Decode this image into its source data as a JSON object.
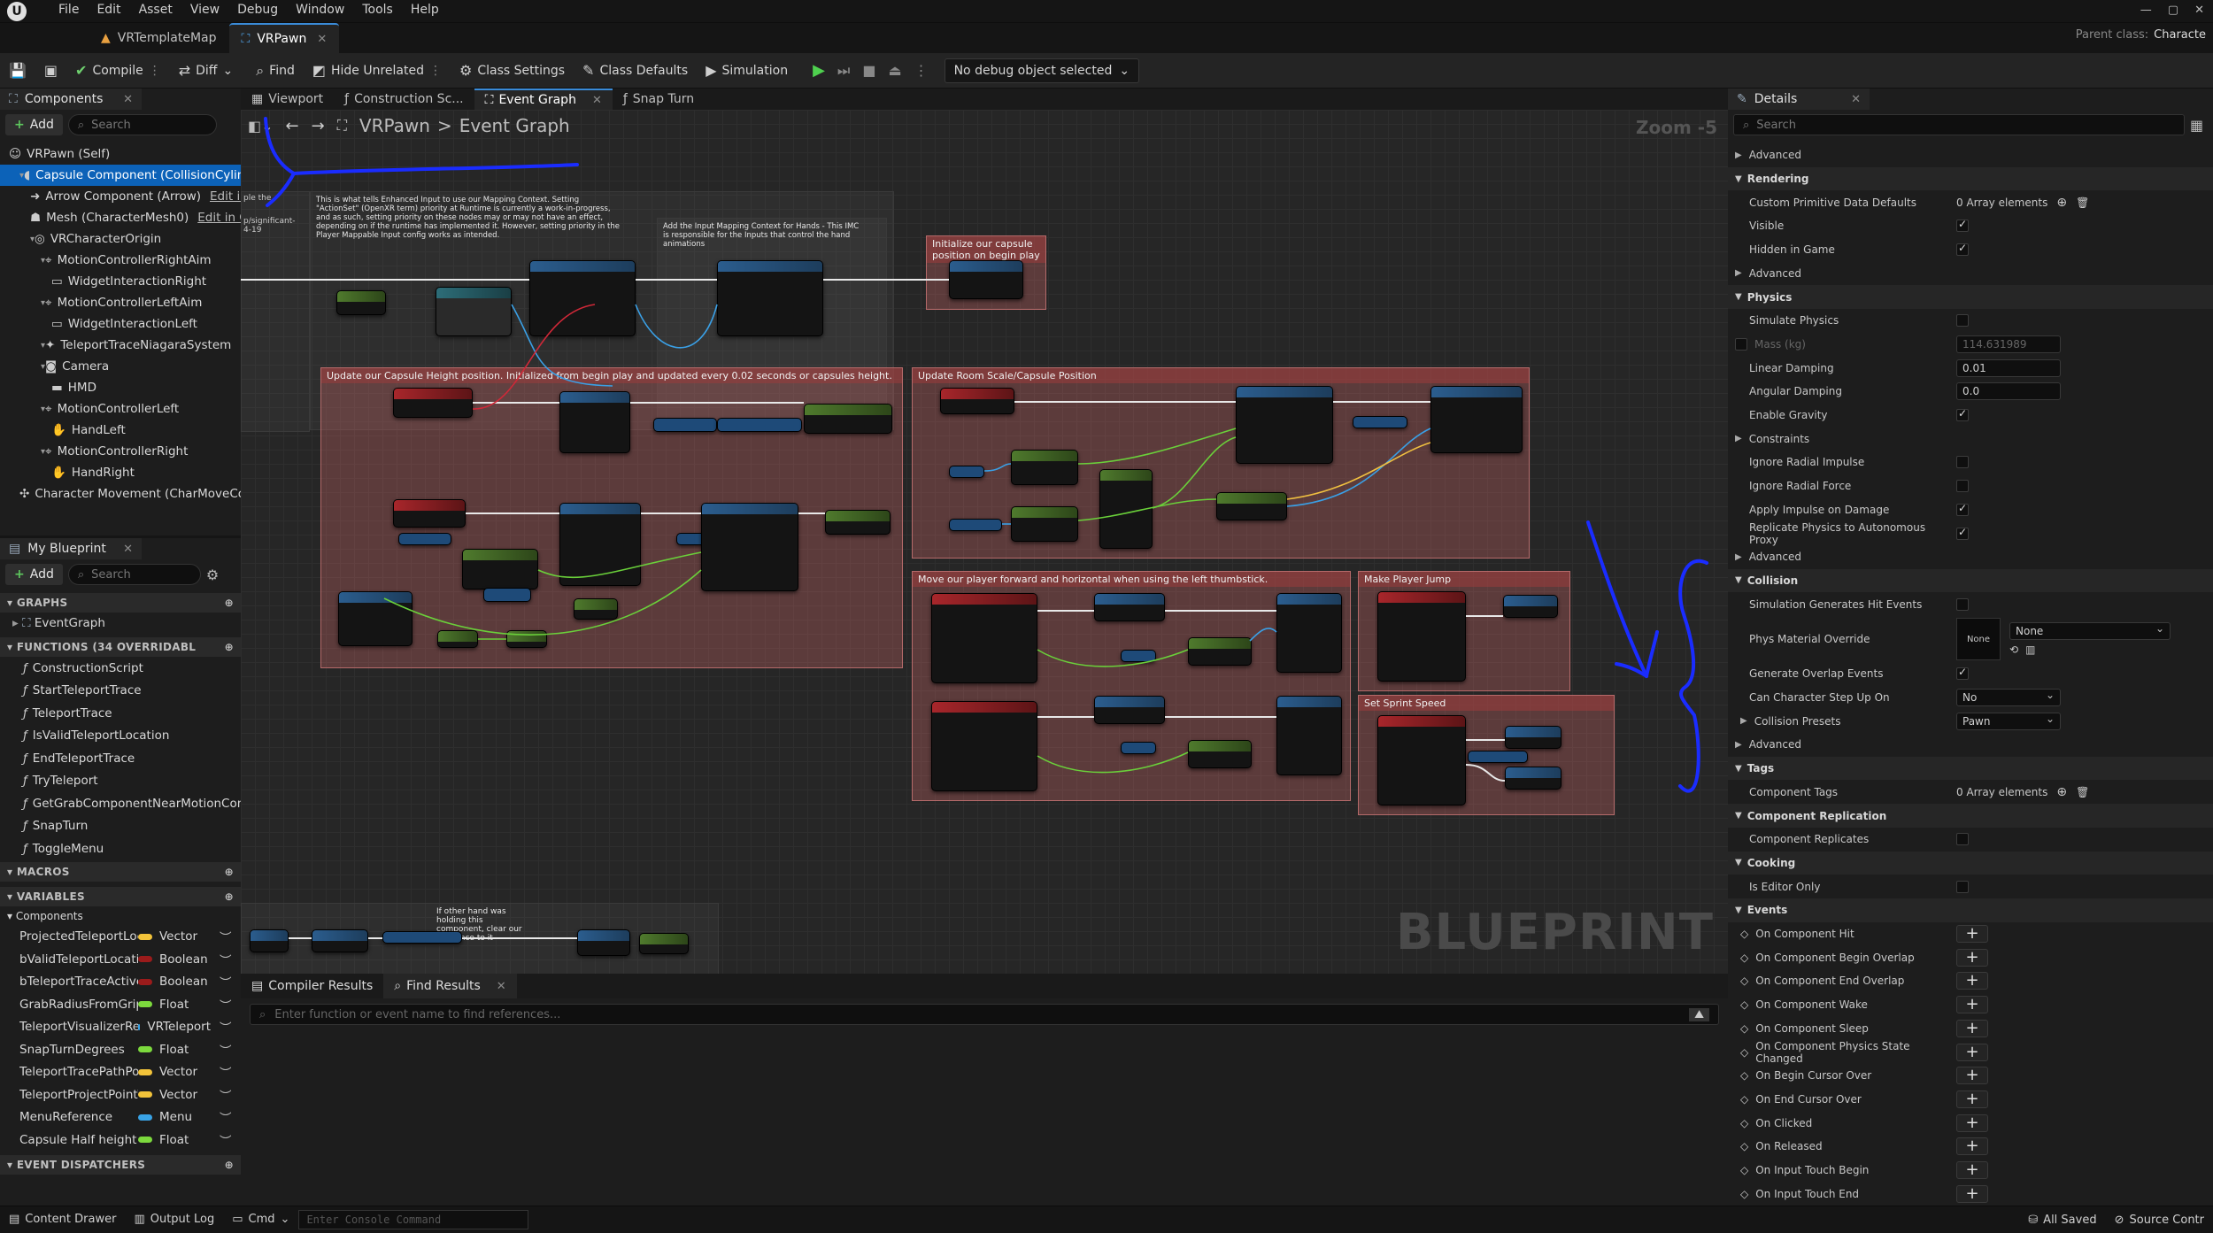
{
  "menu": [
    "File",
    "Edit",
    "Asset",
    "View",
    "Debug",
    "Window",
    "Tools",
    "Help"
  ],
  "doc_tabs": [
    {
      "label": "VRTemplateMap",
      "active": false
    },
    {
      "label": "VRPawn",
      "active": true
    }
  ],
  "parent_class": {
    "label": "Parent class:",
    "value": "Characte"
  },
  "toolbar": {
    "compile": "Compile",
    "diff": "Diff",
    "find": "Find",
    "hide_unrelated": "Hide Unrelated",
    "class_settings": "Class Settings",
    "class_defaults": "Class Defaults",
    "simulation": "Simulation",
    "debug_object": "No debug object selected"
  },
  "components": {
    "tab": "Components",
    "add": "Add",
    "search_placeholder": "Search",
    "items": [
      {
        "label": "VRPawn (Self)",
        "indent": 0,
        "icon": "person-icon",
        "selected": false,
        "suffix": ""
      },
      {
        "label": "Capsule Component (CollisionCylin",
        "indent": 1,
        "icon": "capsule-icon",
        "selected": true,
        "suffix": ""
      },
      {
        "label": "Arrow Component (Arrow)",
        "indent": 2,
        "icon": "arrow-icon",
        "selected": false,
        "suffix": "Edit ir"
      },
      {
        "label": "Mesh (CharacterMesh0)",
        "indent": 2,
        "icon": "mesh-icon",
        "selected": false,
        "suffix": "Edit in C"
      },
      {
        "label": "VRCharacterOrigin",
        "indent": 2,
        "icon": "scene-icon",
        "selected": false,
        "suffix": ""
      },
      {
        "label": "MotionControllerRightAim",
        "indent": 3,
        "icon": "controller-icon",
        "selected": false,
        "suffix": ""
      },
      {
        "label": "WidgetInteractionRight",
        "indent": 4,
        "icon": "widget-icon",
        "selected": false,
        "suffix": ""
      },
      {
        "label": "MotionControllerLeftAim",
        "indent": 3,
        "icon": "controller-icon",
        "selected": false,
        "suffix": ""
      },
      {
        "label": "WidgetInteractionLeft",
        "indent": 4,
        "icon": "widget-icon",
        "selected": false,
        "suffix": ""
      },
      {
        "label": "TeleportTraceNiagaraSystem",
        "indent": 3,
        "icon": "niagara-icon",
        "selected": false,
        "suffix": ""
      },
      {
        "label": "Camera",
        "indent": 3,
        "icon": "camera-icon",
        "selected": false,
        "suffix": ""
      },
      {
        "label": "HMD",
        "indent": 4,
        "icon": "hmd-icon",
        "selected": false,
        "suffix": ""
      },
      {
        "label": "MotionControllerLeft",
        "indent": 3,
        "icon": "controller-icon",
        "selected": false,
        "suffix": ""
      },
      {
        "label": "HandLeft",
        "indent": 4,
        "icon": "hand-icon",
        "selected": false,
        "suffix": ""
      },
      {
        "label": "MotionControllerRight",
        "indent": 3,
        "icon": "controller-icon",
        "selected": false,
        "suffix": ""
      },
      {
        "label": "HandRight",
        "indent": 4,
        "icon": "hand-icon",
        "selected": false,
        "suffix": ""
      },
      {
        "label": "Character Movement (CharMoveCo",
        "indent": 1,
        "icon": "movement-icon",
        "selected": false,
        "suffix": ""
      }
    ]
  },
  "my_blueprint": {
    "tab": "My Blueprint",
    "add": "Add",
    "search_placeholder": "Search",
    "graphs_header": "GRAPHS",
    "graphs": [
      "EventGraph"
    ],
    "functions_header": "FUNCTIONS (34 OVERRIDABL",
    "functions": [
      "ConstructionScript",
      "StartTeleportTrace",
      "TeleportTrace",
      "IsValidTeleportLocation",
      "EndTeleportTrace",
      "TryTeleport",
      "GetGrabComponentNearMotionContro",
      "SnapTurn",
      "ToggleMenu"
    ],
    "macros_header": "MACROS",
    "variables_header": "VARIABLES",
    "variables_category": "Components",
    "variables": [
      {
        "name": "ProjectedTeleportLoca",
        "type": "Vector",
        "color": "#f2c33a"
      },
      {
        "name": "bValidTeleportLocatio",
        "type": "Boolean",
        "color": "#9b1b1b"
      },
      {
        "name": "bTeleportTraceActive",
        "type": "Boolean",
        "color": "#9b1b1b"
      },
      {
        "name": "GrabRadiusFromGripF",
        "type": "Float",
        "color": "#7cd93d"
      },
      {
        "name": "TeleportVisualizerRefe",
        "type": "VRTeleport",
        "color": "#39a3e6"
      },
      {
        "name": "SnapTurnDegrees",
        "type": "Float",
        "color": "#7cd93d"
      },
      {
        "name": "TeleportTracePathPos",
        "type": "Vector",
        "color": "#f2c33a"
      },
      {
        "name": "TeleportProjectPointT",
        "type": "Vector",
        "color": "#f2c33a"
      },
      {
        "name": "MenuReference",
        "type": "Menu",
        "color": "#39a3e6"
      },
      {
        "name": "Capsule Half height",
        "type": "Float",
        "color": "#7cd93d"
      }
    ],
    "dispatchers_header": "EVENT DISPATCHERS"
  },
  "graph_tabs": [
    "Viewport",
    "Construction Sc...",
    "Event Graph",
    "Snap Turn"
  ],
  "breadcrumb": {
    "root": "VRPawn",
    "separator": ">",
    "current": "Event Graph"
  },
  "zoom": "Zoom -5",
  "watermark": "BLUEPRINT",
  "comments": {
    "c_enhanced": "This is what tells Enhanced Input to use our Mapping Context. Setting \"ActionSet\" (OpenXR term) priority at Runtime is currently a work-in-progress, and as such, setting priority on these nodes may or may not have an effect, depending on if the runtime has implemented it. However, setting priority in the Player Mappable Input config works as intended.",
    "c_hands": "Add the Input Mapping Context for Hands - This IMC is responsible for the Inputs that control the hand animations",
    "c_init": "Initialize our capsule position on begin play",
    "c_capsule": "Update our Capsule Height position. Initialized from begin play and updated every 0.02 seconds or capsules height.",
    "c_room": "Update Room Scale/Capsule Position",
    "c_move": "Move our player forward and horizontal when using the left thumbstick.",
    "c_jump": "Make Player Jump",
    "c_sprint": "Set Sprint Speed",
    "c_hold": "If other hand was holding this component, clear our reference to it",
    "c_left_a": "ple the",
    "c_left_b": "p/significant-\n4-19"
  },
  "bottom_panel": {
    "tabs": [
      "Compiler Results",
      "Find Results"
    ],
    "find_placeholder": "Enter function or event name to find references..."
  },
  "details": {
    "tab": "Details",
    "search_placeholder": "Search",
    "rows": [
      {
        "type": "sub",
        "label": "Advanced"
      },
      {
        "type": "sec",
        "label": "Rendering"
      },
      {
        "type": "text",
        "label": "Custom Primitive Data Defaults",
        "value": "0 Array elements"
      },
      {
        "type": "check",
        "label": "Visible",
        "checked": true
      },
      {
        "type": "check",
        "label": "Hidden in Game",
        "checked": true
      },
      {
        "type": "sub",
        "label": "Advanced"
      },
      {
        "type": "sec",
        "label": "Physics"
      },
      {
        "type": "check",
        "label": "Simulate Physics",
        "checked": false
      },
      {
        "type": "mass",
        "label": "Mass (kg)",
        "value": "114.631989"
      },
      {
        "type": "input",
        "label": "Linear Damping",
        "value": "0.01"
      },
      {
        "type": "input",
        "label": "Angular Damping",
        "value": "0.0"
      },
      {
        "type": "check",
        "label": "Enable Gravity",
        "checked": true
      },
      {
        "type": "sub",
        "label": "Constraints"
      },
      {
        "type": "check",
        "label": "Ignore Radial Impulse",
        "checked": false
      },
      {
        "type": "check",
        "label": "Ignore Radial Force",
        "checked": false
      },
      {
        "type": "check",
        "label": "Apply Impulse on Damage",
        "checked": true
      },
      {
        "type": "check",
        "label": "Replicate Physics to Autonomous Proxy",
        "checked": true
      },
      {
        "type": "sub",
        "label": "Advanced"
      },
      {
        "type": "sec",
        "label": "Collision"
      },
      {
        "type": "check",
        "label": "Simulation Generates Hit Events",
        "checked": false
      },
      {
        "type": "physmat",
        "label": "Phys Material Override",
        "thumb": "None",
        "value": "None"
      },
      {
        "type": "check",
        "label": "Generate Overlap Events",
        "checked": true
      },
      {
        "type": "dropdown",
        "label": "Can Character Step Up On",
        "value": "No"
      },
      {
        "type": "dropdown",
        "label": "Collision Presets",
        "value": "Pawn",
        "sub": true
      },
      {
        "type": "sub",
        "label": "Advanced"
      },
      {
        "type": "sec",
        "label": "Tags"
      },
      {
        "type": "text",
        "label": "Component Tags",
        "value": "0 Array elements"
      },
      {
        "type": "sec",
        "label": "Component Replication"
      },
      {
        "type": "check",
        "label": "Component Replicates",
        "checked": false
      },
      {
        "type": "sec",
        "label": "Cooking"
      },
      {
        "type": "check",
        "label": "Is Editor Only",
        "checked": false
      },
      {
        "type": "sec",
        "label": "Events"
      },
      {
        "type": "event",
        "label": "On Component Hit"
      },
      {
        "type": "event",
        "label": "On Component Begin Overlap"
      },
      {
        "type": "event",
        "label": "On Component End Overlap"
      },
      {
        "type": "event",
        "label": "On Component Wake"
      },
      {
        "type": "event",
        "label": "On Component Sleep"
      },
      {
        "type": "event",
        "label": "On Component Physics State Changed"
      },
      {
        "type": "event",
        "label": "On Begin Cursor Over"
      },
      {
        "type": "event",
        "label": "On End Cursor Over"
      },
      {
        "type": "event",
        "label": "On Clicked"
      },
      {
        "type": "event",
        "label": "On Released"
      },
      {
        "type": "event",
        "label": "On Input Touch Begin"
      },
      {
        "type": "event",
        "label": "On Input Touch End"
      }
    ]
  },
  "status": {
    "content_drawer": "Content Drawer",
    "output_log": "Output Log",
    "cmd": "Cmd",
    "console_placeholder": "Enter Console Command",
    "all_saved": "All Saved",
    "source_control": "Source Contr"
  },
  "colors": {
    "accent": "#3a8bd8",
    "annotation": "#1a2cff",
    "comment": "#b56a6a"
  }
}
